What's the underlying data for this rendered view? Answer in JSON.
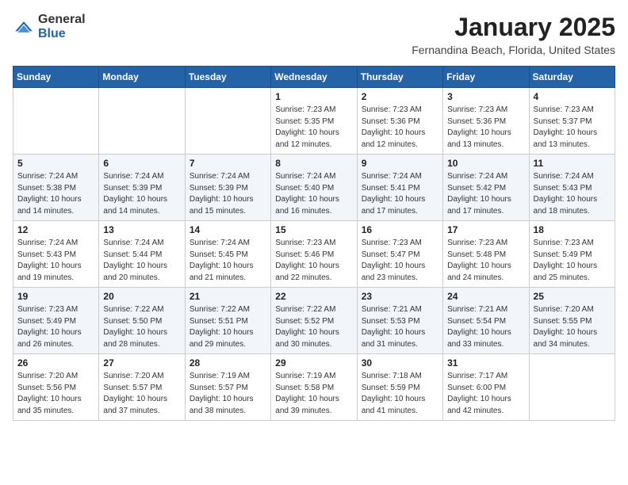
{
  "header": {
    "logo": {
      "general": "General",
      "blue": "Blue"
    },
    "title": "January 2025",
    "subtitle": "Fernandina Beach, Florida, United States"
  },
  "weekdays": [
    "Sunday",
    "Monday",
    "Tuesday",
    "Wednesday",
    "Thursday",
    "Friday",
    "Saturday"
  ],
  "weeks": [
    [
      {
        "day": "",
        "info": ""
      },
      {
        "day": "",
        "info": ""
      },
      {
        "day": "",
        "info": ""
      },
      {
        "day": "1",
        "info": "Sunrise: 7:23 AM\nSunset: 5:35 PM\nDaylight: 10 hours and 12 minutes."
      },
      {
        "day": "2",
        "info": "Sunrise: 7:23 AM\nSunset: 5:36 PM\nDaylight: 10 hours and 12 minutes."
      },
      {
        "day": "3",
        "info": "Sunrise: 7:23 AM\nSunset: 5:36 PM\nDaylight: 10 hours and 13 minutes."
      },
      {
        "day": "4",
        "info": "Sunrise: 7:23 AM\nSunset: 5:37 PM\nDaylight: 10 hours and 13 minutes."
      }
    ],
    [
      {
        "day": "5",
        "info": "Sunrise: 7:24 AM\nSunset: 5:38 PM\nDaylight: 10 hours and 14 minutes."
      },
      {
        "day": "6",
        "info": "Sunrise: 7:24 AM\nSunset: 5:39 PM\nDaylight: 10 hours and 14 minutes."
      },
      {
        "day": "7",
        "info": "Sunrise: 7:24 AM\nSunset: 5:39 PM\nDaylight: 10 hours and 15 minutes."
      },
      {
        "day": "8",
        "info": "Sunrise: 7:24 AM\nSunset: 5:40 PM\nDaylight: 10 hours and 16 minutes."
      },
      {
        "day": "9",
        "info": "Sunrise: 7:24 AM\nSunset: 5:41 PM\nDaylight: 10 hours and 17 minutes."
      },
      {
        "day": "10",
        "info": "Sunrise: 7:24 AM\nSunset: 5:42 PM\nDaylight: 10 hours and 17 minutes."
      },
      {
        "day": "11",
        "info": "Sunrise: 7:24 AM\nSunset: 5:43 PM\nDaylight: 10 hours and 18 minutes."
      }
    ],
    [
      {
        "day": "12",
        "info": "Sunrise: 7:24 AM\nSunset: 5:43 PM\nDaylight: 10 hours and 19 minutes."
      },
      {
        "day": "13",
        "info": "Sunrise: 7:24 AM\nSunset: 5:44 PM\nDaylight: 10 hours and 20 minutes."
      },
      {
        "day": "14",
        "info": "Sunrise: 7:24 AM\nSunset: 5:45 PM\nDaylight: 10 hours and 21 minutes."
      },
      {
        "day": "15",
        "info": "Sunrise: 7:23 AM\nSunset: 5:46 PM\nDaylight: 10 hours and 22 minutes."
      },
      {
        "day": "16",
        "info": "Sunrise: 7:23 AM\nSunset: 5:47 PM\nDaylight: 10 hours and 23 minutes."
      },
      {
        "day": "17",
        "info": "Sunrise: 7:23 AM\nSunset: 5:48 PM\nDaylight: 10 hours and 24 minutes."
      },
      {
        "day": "18",
        "info": "Sunrise: 7:23 AM\nSunset: 5:49 PM\nDaylight: 10 hours and 25 minutes."
      }
    ],
    [
      {
        "day": "19",
        "info": "Sunrise: 7:23 AM\nSunset: 5:49 PM\nDaylight: 10 hours and 26 minutes."
      },
      {
        "day": "20",
        "info": "Sunrise: 7:22 AM\nSunset: 5:50 PM\nDaylight: 10 hours and 28 minutes."
      },
      {
        "day": "21",
        "info": "Sunrise: 7:22 AM\nSunset: 5:51 PM\nDaylight: 10 hours and 29 minutes."
      },
      {
        "day": "22",
        "info": "Sunrise: 7:22 AM\nSunset: 5:52 PM\nDaylight: 10 hours and 30 minutes."
      },
      {
        "day": "23",
        "info": "Sunrise: 7:21 AM\nSunset: 5:53 PM\nDaylight: 10 hours and 31 minutes."
      },
      {
        "day": "24",
        "info": "Sunrise: 7:21 AM\nSunset: 5:54 PM\nDaylight: 10 hours and 33 minutes."
      },
      {
        "day": "25",
        "info": "Sunrise: 7:20 AM\nSunset: 5:55 PM\nDaylight: 10 hours and 34 minutes."
      }
    ],
    [
      {
        "day": "26",
        "info": "Sunrise: 7:20 AM\nSunset: 5:56 PM\nDaylight: 10 hours and 35 minutes."
      },
      {
        "day": "27",
        "info": "Sunrise: 7:20 AM\nSunset: 5:57 PM\nDaylight: 10 hours and 37 minutes."
      },
      {
        "day": "28",
        "info": "Sunrise: 7:19 AM\nSunset: 5:57 PM\nDaylight: 10 hours and 38 minutes."
      },
      {
        "day": "29",
        "info": "Sunrise: 7:19 AM\nSunset: 5:58 PM\nDaylight: 10 hours and 39 minutes."
      },
      {
        "day": "30",
        "info": "Sunrise: 7:18 AM\nSunset: 5:59 PM\nDaylight: 10 hours and 41 minutes."
      },
      {
        "day": "31",
        "info": "Sunrise: 7:17 AM\nSunset: 6:00 PM\nDaylight: 10 hours and 42 minutes."
      },
      {
        "day": "",
        "info": ""
      }
    ]
  ]
}
